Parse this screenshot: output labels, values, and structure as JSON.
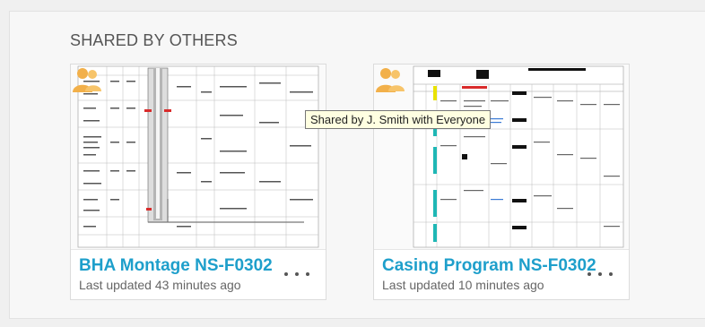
{
  "section": {
    "title": "SHARED BY OTHERS"
  },
  "cards": [
    {
      "title": "BHA Montage NS-F0302",
      "subtitle": "Last updated 43 minutes ago",
      "icon": "shared-users-icon"
    },
    {
      "title": "Casing Program NS-F0302",
      "subtitle": "Last updated 10 minutes ago",
      "icon": "shared-users-icon"
    }
  ],
  "tooltip": {
    "text": "Shared by J. Smith with Everyone"
  },
  "colors": {
    "accent": "#1e9fcb",
    "shared_icon": "#f2b04a",
    "marker_red": "#d92b2b",
    "marker_teal": "#1fb7b5",
    "marker_yellow": "#e9e200"
  }
}
